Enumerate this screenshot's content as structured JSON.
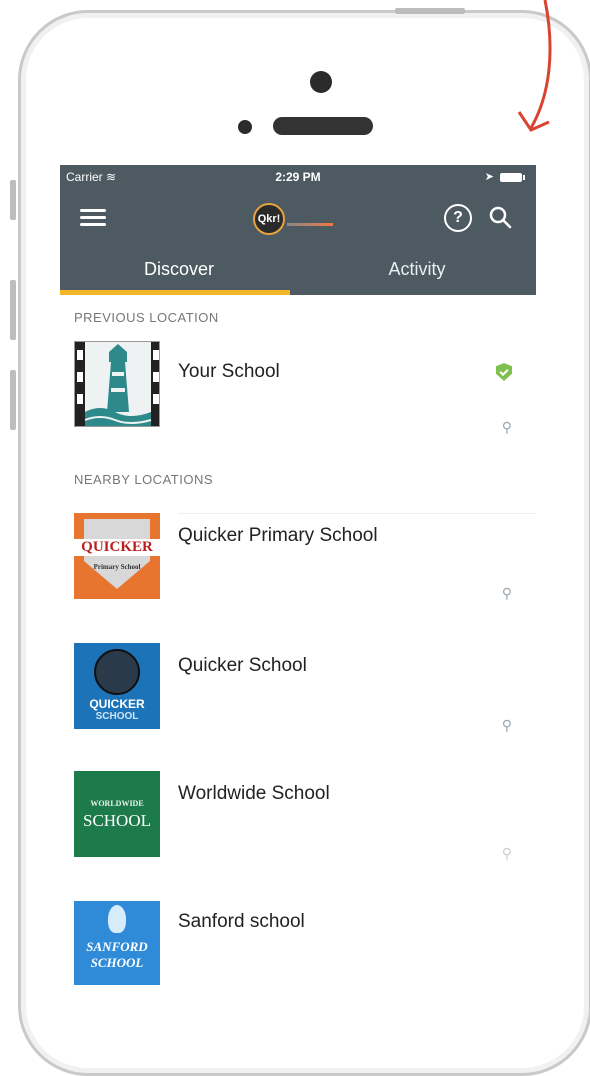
{
  "status": {
    "carrier": "Carrier",
    "time": "2:29 PM"
  },
  "header": {
    "logo_text": "Qkr!"
  },
  "tabs": [
    {
      "label": "Discover",
      "active": true
    },
    {
      "label": "Activity",
      "active": false
    }
  ],
  "previous_location": {
    "section_label": "PREVIOUS LOCATION",
    "item": {
      "name": "Your School",
      "verified": true
    }
  },
  "nearby_locations": {
    "section_label": "NEARBY LOCATIONS",
    "items": [
      {
        "name": "Quicker Primary School",
        "logo_text": "QUICKER",
        "logo_sub": "Primary School"
      },
      {
        "name": "Quicker School",
        "logo_text": "QUICKER",
        "logo_sub": "SCHOOL"
      },
      {
        "name": "Worldwide School",
        "logo_text": "WORLDWIDE",
        "logo_sub": "SCHOOL"
      },
      {
        "name": "Sanford school",
        "logo_text": "SANFORD",
        "logo_sub": "SCHOOL"
      }
    ]
  },
  "colors": {
    "header_bg": "#4d5a61",
    "tab_underline": "#f3b628",
    "verified_green": "#7fbf4d",
    "annotation_arrow": "#d9432f"
  },
  "icons": [
    "menu-icon",
    "help-icon",
    "search-icon",
    "verified-shield-icon",
    "location-pin-icon",
    "wifi-icon",
    "battery-icon"
  ]
}
